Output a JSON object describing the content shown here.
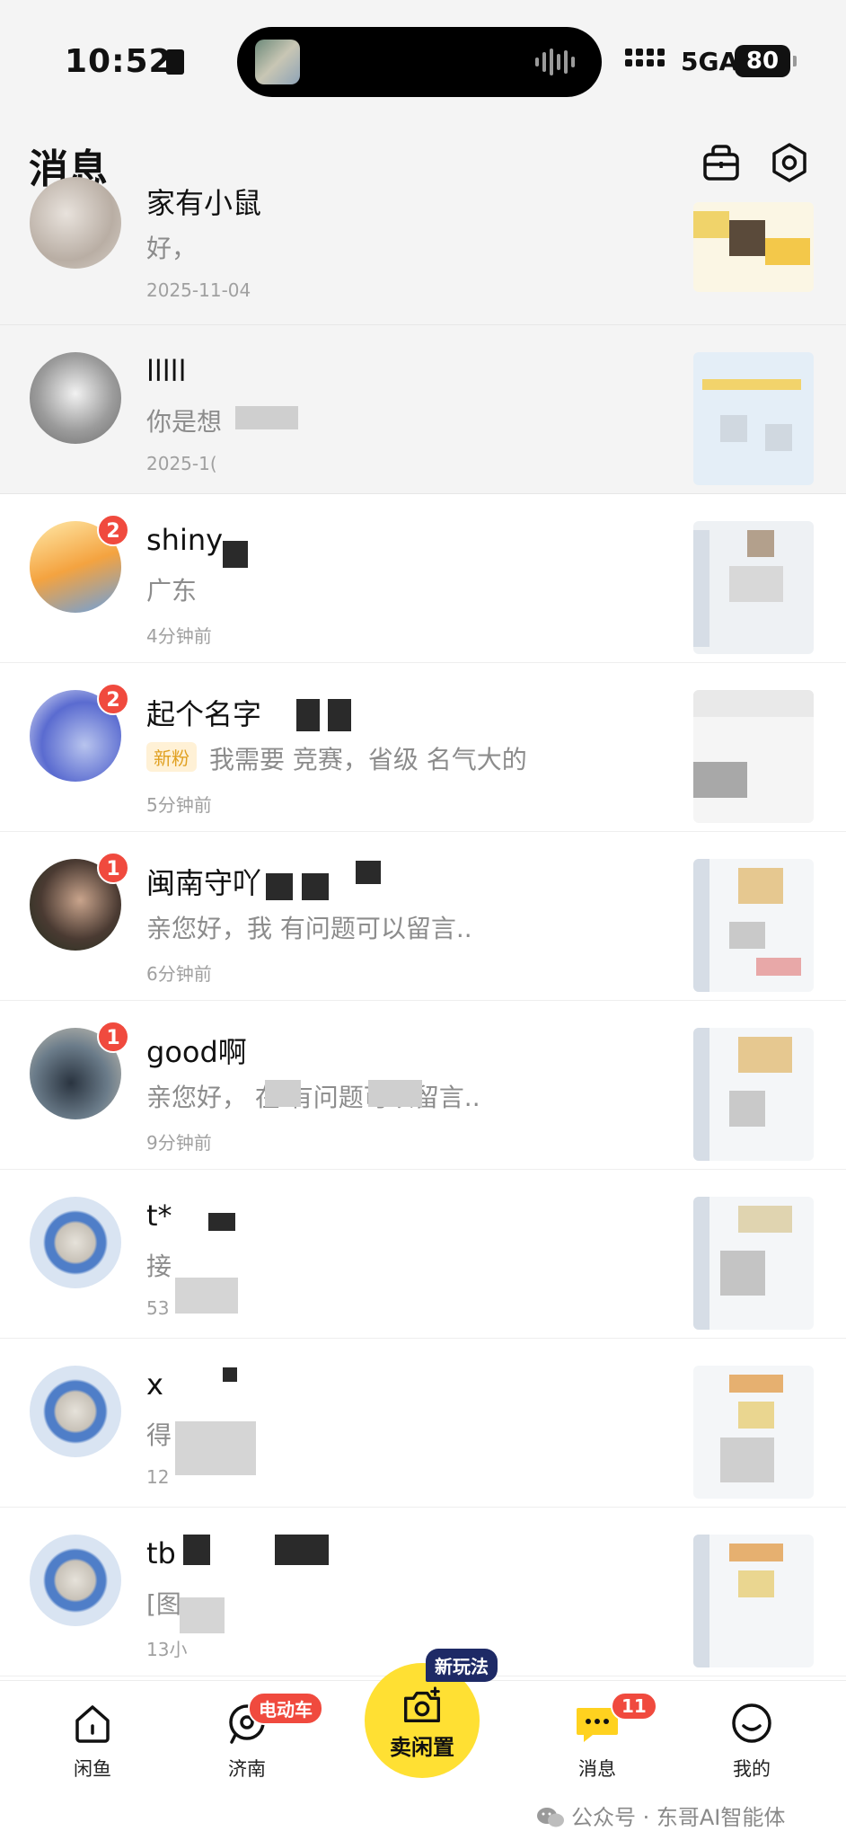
{
  "status_bar": {
    "time": "10:52",
    "network": "5GA",
    "battery": "80"
  },
  "header": {
    "title": "消息"
  },
  "conversations": [
    {
      "name": "家有小鼠",
      "preview": "好，",
      "time": "2025-11-04",
      "badge": "",
      "tag": ""
    },
    {
      "name": "lllll",
      "preview": "你是想",
      "time": "2025-1(",
      "badge": "",
      "tag": ""
    },
    {
      "name": "shiny",
      "preview": "广东",
      "time": "4分钟前",
      "badge": "2",
      "tag": ""
    },
    {
      "name": "起个名字",
      "preview": "我需要 竞赛，省级 名气大的",
      "time": "5分钟前",
      "badge": "2",
      "tag": "新粉"
    },
    {
      "name": "闽南守吖",
      "preview": "亲您好，我 有问题可以留言..",
      "time": "6分钟前",
      "badge": "1",
      "tag": ""
    },
    {
      "name": "good啊",
      "preview": "亲您好， 在 有问题可以留言..",
      "time": "9分钟前",
      "badge": "1",
      "tag": ""
    },
    {
      "name": "t*",
      "preview": "接",
      "time": "53",
      "badge": "",
      "tag": ""
    },
    {
      "name": "x",
      "preview": "得",
      "time": "12",
      "badge": "",
      "tag": ""
    },
    {
      "name": "tb k",
      "preview": "[图",
      "time": "13小",
      "badge": "",
      "tag": ""
    }
  ],
  "tabbar": {
    "home_label": "闲鱼",
    "city_label": "济南",
    "city_badge": "电动车",
    "sell_label": "卖闲置",
    "sell_tag": "新玩法",
    "messages_label": "消息",
    "messages_badge": "11",
    "me_label": "我的"
  },
  "watermark": "公众号 · 东哥AI智能体",
  "colors": {
    "accent_yellow": "#ffe033",
    "badge_red": "#f04a3e",
    "tag_navy": "#1e2a66"
  },
  "icons": [
    "book-icon",
    "bag-icon",
    "settings-icon",
    "home-icon",
    "location-icon",
    "camera-icon",
    "chat-icon",
    "smile-icon",
    "wechat-icon"
  ]
}
